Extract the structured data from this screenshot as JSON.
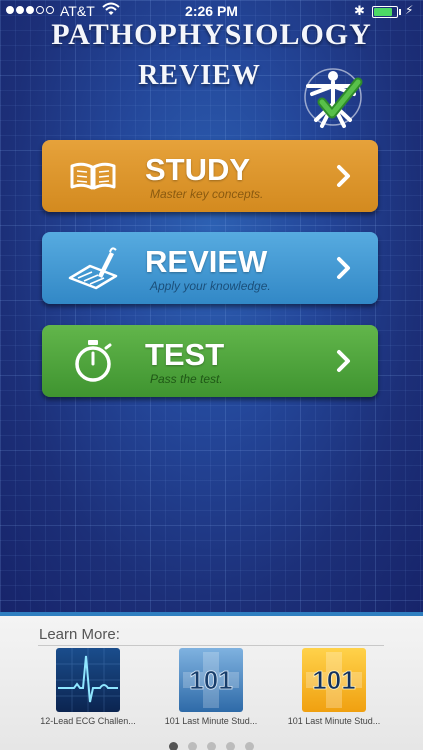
{
  "status_bar": {
    "carrier": "AT&T",
    "time": "2:26 PM",
    "bluetooth_symbol": "✱",
    "charge_symbol": "⚡",
    "battery_level_pct": 85,
    "signal_bars_filled": 3,
    "signal_bars_total": 5
  },
  "header": {
    "title_line1": "PATHOPHYSIOLOGY",
    "title_line2": "REVIEW",
    "logo_icon": "anatomy-figure-checkmark-icon"
  },
  "menu": [
    {
      "label": "STUDY",
      "subtitle": "Master key concepts.",
      "icon": "open-book-icon",
      "color": "#e09a33"
    },
    {
      "label": "REVIEW",
      "subtitle": "Apply your knowledge.",
      "icon": "pen-checklist-icon",
      "color": "#4aa1db"
    },
    {
      "label": "TEST",
      "subtitle": "Pass the test.",
      "icon": "stopwatch-icon",
      "color": "#55ab3f"
    }
  ],
  "learn_more": {
    "title": "Learn More:",
    "apps": [
      {
        "name": "12-Lead ECG Challen...",
        "icon": "ecg-waveform-icon"
      },
      {
        "name": "101 Last Minute Stud...",
        "icon": "101-blue-cross-icon",
        "icon_text": "101"
      },
      {
        "name": "101 Last Minute Stud...",
        "icon": "101-yellow-cross-icon",
        "icon_text": "101"
      }
    ],
    "page_count": 5,
    "active_page": 1
  },
  "colors": {
    "background_blue": "#1b2f77",
    "accent_blue": "#2f7fc0",
    "battery_green": "#4cd964"
  }
}
